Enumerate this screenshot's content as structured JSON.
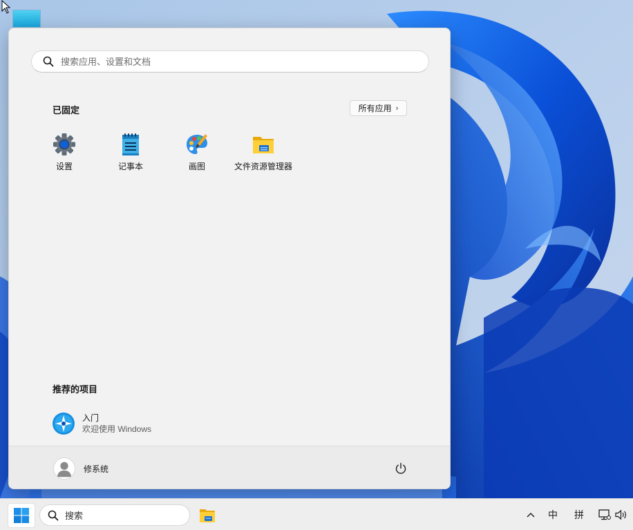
{
  "start_menu": {
    "search": {
      "placeholder": "搜索应用、设置和文档",
      "value": ""
    },
    "pinned": {
      "title": "已固定",
      "all_apps_label": "所有应用",
      "apps": [
        {
          "label": "设置",
          "icon": "gear-icon"
        },
        {
          "label": "记事本",
          "icon": "notepad-icon"
        },
        {
          "label": "画图",
          "icon": "paint-palette-icon"
        },
        {
          "label": "文件资源管理器",
          "icon": "folder-icon"
        }
      ]
    },
    "recommended": {
      "title": "推荐的项目",
      "items": [
        {
          "title": "入门",
          "subtitle": "欢迎使用 Windows",
          "icon": "get-started-icon"
        }
      ]
    },
    "footer": {
      "user_name": "修系统",
      "avatar_icon": "user-avatar-icon",
      "power_icon": "power-icon"
    }
  },
  "taskbar": {
    "start_icon": "windows-logo-icon",
    "search_label": "搜索",
    "pinned": [
      {
        "icon": "folder-icon"
      }
    ],
    "tray": {
      "chevron": "^",
      "ime_language": "中",
      "ime_mode": "拼",
      "network_icon": "network-icon",
      "volume_icon": "volume-icon"
    }
  },
  "colors": {
    "accent": "#0067c0",
    "menu_background": "#f2f2f2",
    "taskbar_background": "#eeeeee",
    "wallpaper_blue": "#1565e0"
  }
}
